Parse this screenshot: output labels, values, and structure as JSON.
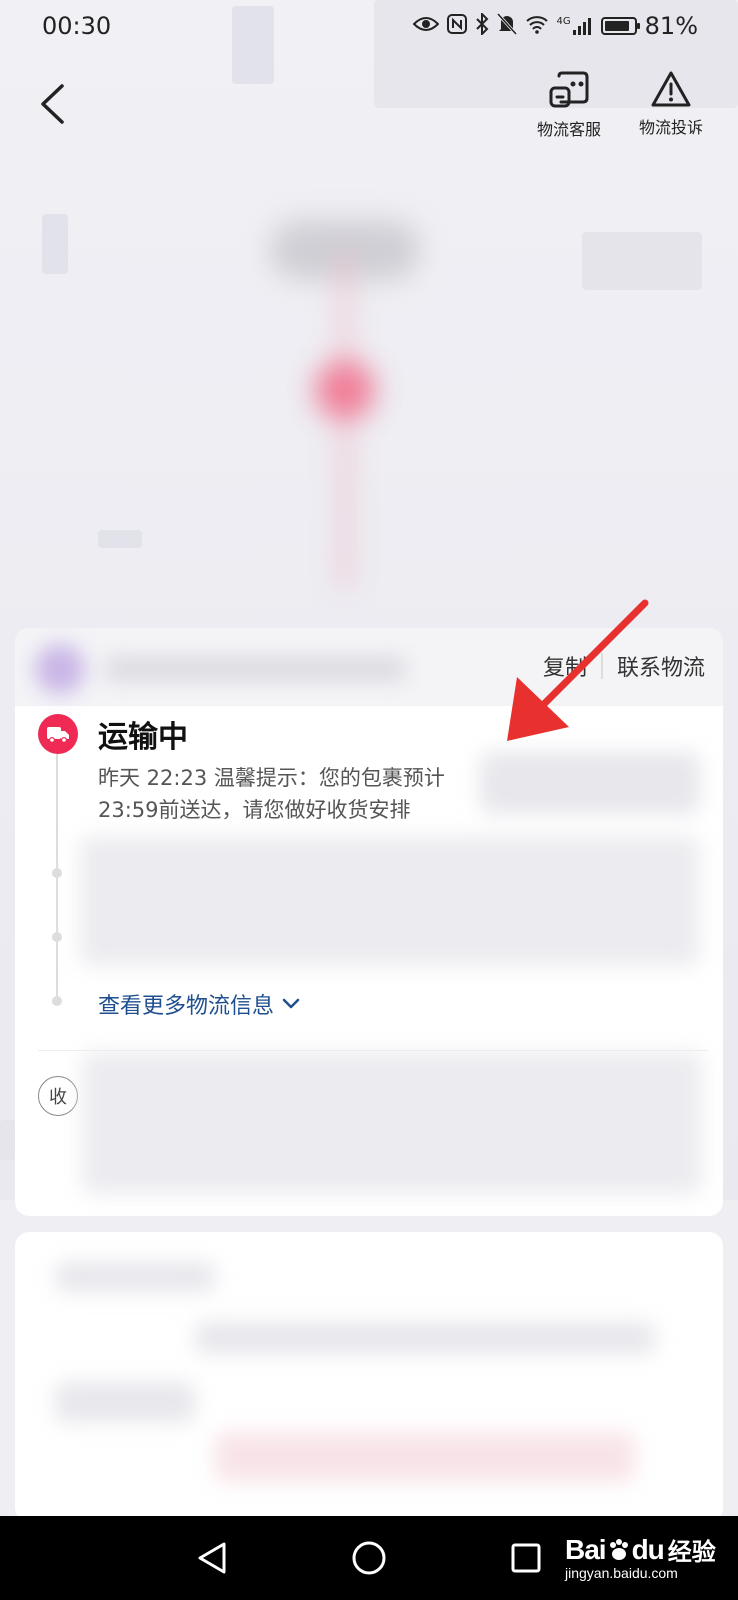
{
  "status_bar": {
    "time": "00:30",
    "battery_percent": "81%",
    "network": "4G"
  },
  "header": {
    "service_label": "物流客服",
    "complain_label": "物流投诉"
  },
  "card": {
    "copy_label": "复制",
    "contact_label": "联系物流",
    "status_title": "运输中",
    "status_desc": "昨天 22:23 温馨提示：您的包裹预计23:59前送达，请您做好收货安排",
    "more_link": "查看更多物流信息",
    "receiver_badge": "收"
  },
  "watermark": {
    "brand": "Bai",
    "brand_suffix": "du",
    "jingyan": "经验",
    "url": "jingyan.baidu.com"
  },
  "colors": {
    "accent_red": "#ee2a55",
    "link_blue": "#1f4f8f",
    "arrow_red": "#e8302e"
  }
}
